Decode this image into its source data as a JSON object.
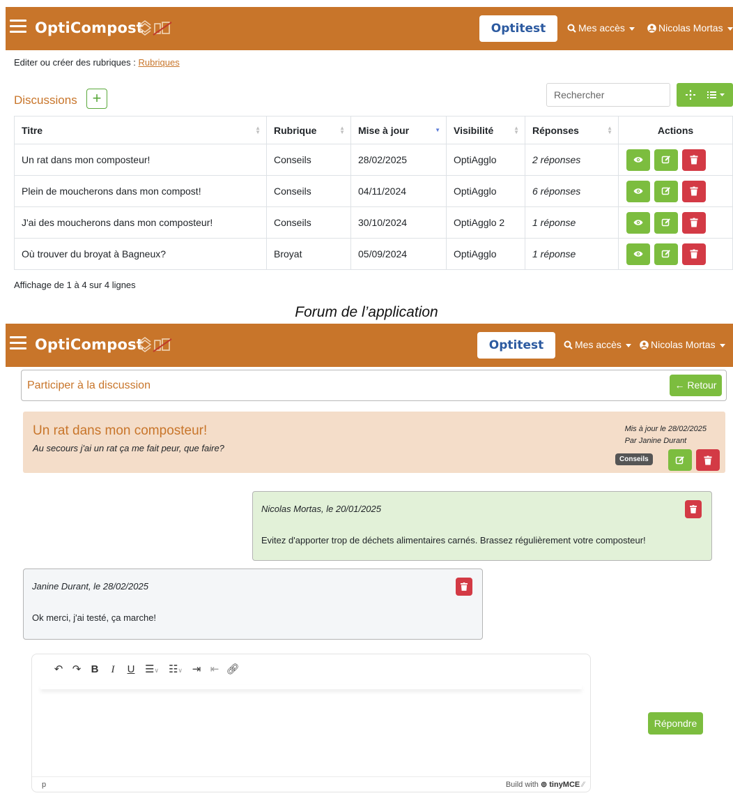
{
  "app": {
    "brand": "OptiCompost",
    "env_button": "Optitest",
    "access_menu": "Mes accès",
    "user_menu": "Nicolas Mortas"
  },
  "colors": {
    "brand_orange": "#c8752a",
    "green": "#7cbd3f",
    "red": "#d33a45",
    "blue": "#2c5aa0"
  },
  "top": {
    "edit_prefix": "Editer ou créer des rubriques : ",
    "edit_link": "Rubriques",
    "discussions_title": "Discussions",
    "add_symbol": "+",
    "search_placeholder": "Rechercher",
    "table": {
      "headers": [
        "Titre",
        "Rubrique",
        "Mise à jour",
        "Visibilité",
        "Réponses",
        "Actions"
      ],
      "rows": [
        {
          "titre": "Un rat dans mon composteur!",
          "rubrique": "Conseils",
          "date": "28/02/2025",
          "visibilite": "OptiAgglo",
          "reponses": "2 réponses"
        },
        {
          "titre": "Plein de moucherons dans mon compost!",
          "rubrique": "Conseils",
          "date": "04/11/2024",
          "visibilite": "OptiAgglo",
          "reponses": "6 réponses"
        },
        {
          "titre": "J'ai des moucherons dans mon composteur!",
          "rubrique": "Conseils",
          "date": "30/10/2024",
          "visibilite": "OptiAgglo 2",
          "reponses": "1 réponse"
        },
        {
          "titre": "Où trouver du broyat à Bagneux?",
          "rubrique": "Broyat",
          "date": "05/09/2024",
          "visibilite": "OptiAgglo",
          "reponses": "1 réponse"
        }
      ]
    },
    "footer_info": "Affichage de 1 à 4 sur 4 lignes"
  },
  "caption": "Forum de l’application",
  "bottom": {
    "participate_title": "Participer à la discussion",
    "back_button": "← Retour",
    "post": {
      "title": "Un rat dans mon composteur!",
      "subtitle": "Au secours j'ai un rat ça me fait peur, que faire?",
      "updated": "Mis à jour le 28/02/2025",
      "author": "Par Janine Durant",
      "badge": "Conseils"
    },
    "messages": [
      {
        "author": "Nicolas Mortas, le 20/01/2025",
        "text": "Evitez d'apporter trop de déchets alimentaires carnés. Brassez régulièrement votre composteur!"
      },
      {
        "author": "Janine Durant, le 28/02/2025",
        "text": "Ok merci, j'ai testé, ça marche!"
      }
    ],
    "editor": {
      "status_element": "p",
      "build_with": "Build with",
      "tiny_brand": "tinyMCE"
    },
    "reply_button": "Répondre"
  }
}
